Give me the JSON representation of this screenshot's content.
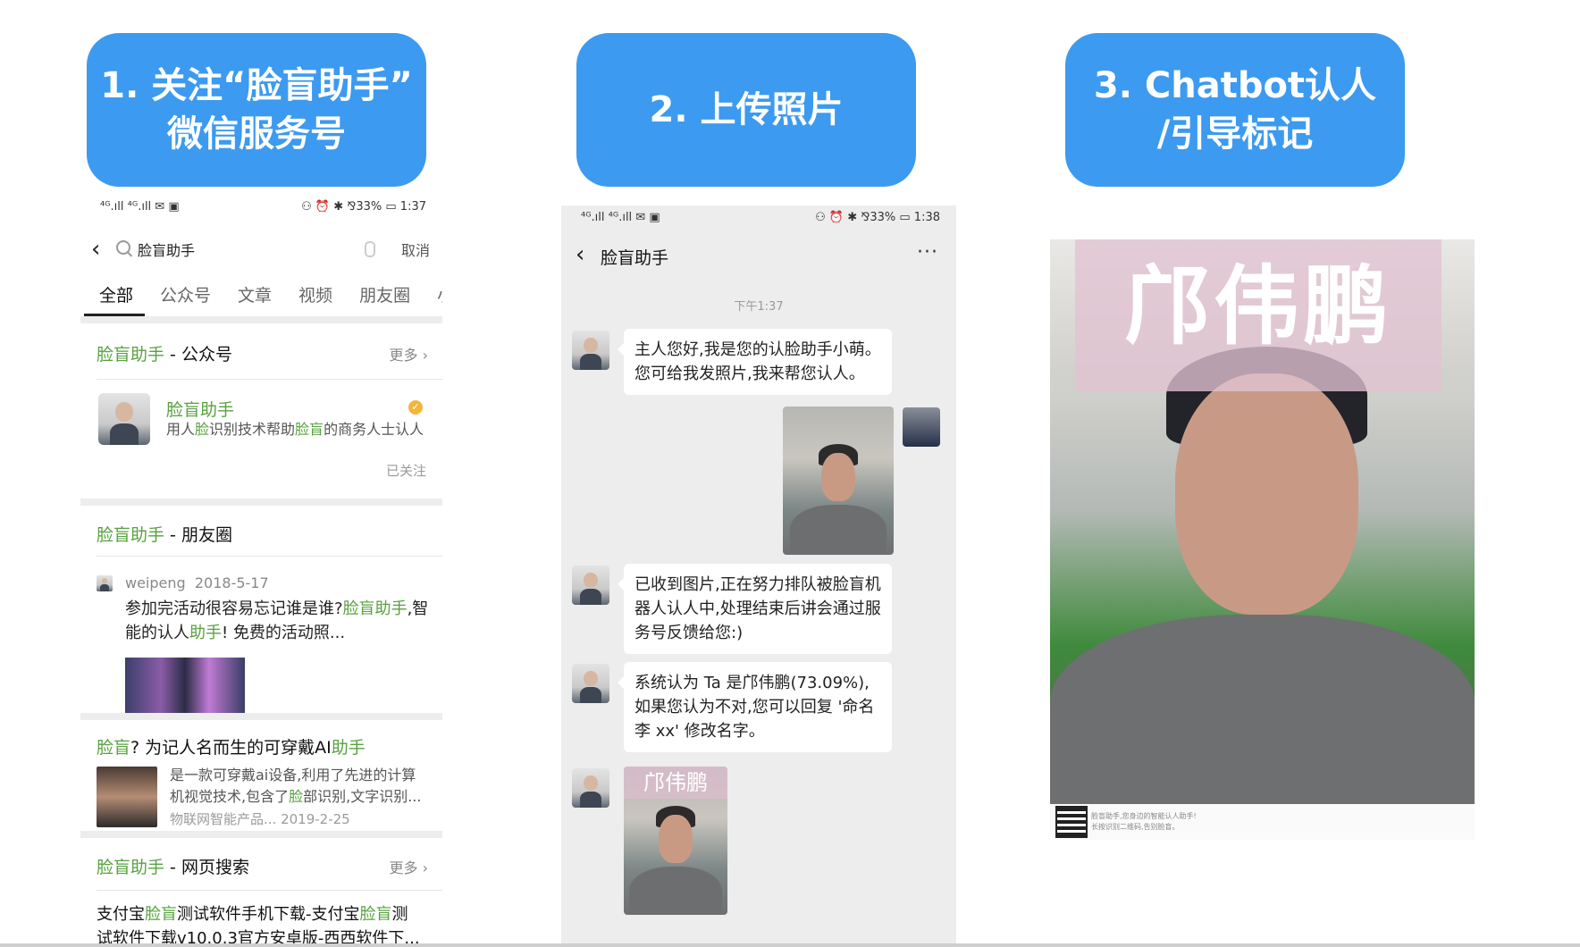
{
  "steps": [
    {
      "line1": "1. 关注“脸盲助手”",
      "line2": "微信服务号"
    },
    {
      "line1": "2. 上传照片",
      "line2": ""
    },
    {
      "line1": "3. Chatbot认人",
      "line2": "/引导标记"
    }
  ],
  "phone1": {
    "status_left": "⁴ᴳ.ıll ⁴ᴳ.ıll ✉ ▣",
    "status_right": "⚇ ⏰ ✱ ⅋33% ▭ 1:37",
    "search_query": "脸盲助手",
    "cancel": "取消",
    "tabs": [
      "全部",
      "公众号",
      "文章",
      "视频",
      "朋友圈",
      "小程"
    ],
    "official": {
      "title_hl": "脸盲助手",
      "title_rest": " - 公众号",
      "more": "更多",
      "account_name": "脸盲助手",
      "desc_parts": [
        "用人",
        "脸",
        "识别技术帮助",
        "脸盲",
        "的商务人士认人"
      ],
      "followed": "已关注"
    },
    "moments": {
      "title_hl": "脸盲助手",
      "title_rest": " - 朋友圈",
      "user": "weipeng",
      "date": "2018-5-17",
      "text_a": "参加完活动很容易忘记谁是谁?",
      "text_hl1": "脸盲助",
      "text_hl2": "手",
      "text_b": ",智能的认人",
      "text_hl3": "助手",
      "text_c": "! 免费的活动照..."
    },
    "article": {
      "title_hl1": "脸盲",
      "title_mid": "? 为记人名而生的可穿戴AI",
      "title_hl2": "助手",
      "desc_a": "是一款可穿戴ai设备,利用了先进的计算",
      "desc_b": "机视觉技术,包含了",
      "desc_hl": "脸",
      "desc_c": "部识别,文字识别...",
      "source": "物联网智能产品...",
      "date": "2019-2-25"
    },
    "web": {
      "title_hl": "脸盲助手",
      "title_rest": " - 网页搜索",
      "more": "更多",
      "line1_a": "支付宝",
      "line1_hl1": "脸盲",
      "line1_b": "测试软件手机下载-支付宝",
      "line1_hl2": "脸盲",
      "line1_c": "测",
      "line2": "试软件下载v10.0.3官方安卓版-西西软件下..."
    }
  },
  "phone2": {
    "status_left": "⁴ᴳ.ıll ⁴ᴳ.ıll ✉ ▣",
    "status_right": "⚇ ⏰ ✱ ⅋33% ▭ 1:38",
    "title": "脸盲助手",
    "menu": "···",
    "time": "下午1:37",
    "messages": [
      "主人您好,我是您的认脸助手小萌。您可给我发照片,我来帮您认人。",
      "已收到图片,正在努力排队被脸盲机器人认人中,处理结束后讲会通过服务号反馈给您:)",
      "系统认为 Ta 是邝伟鹏(73.09%),如果您认为不对,您可以回复 '命名 李 xx' 修改名字。"
    ],
    "result_name": "邝伟鹏"
  },
  "panel3": {
    "name": "邝伟鹏",
    "footer_line1": "脸盲助手,您身边的智能认人助手!",
    "footer_line2": "长按识别二维码,告别脸盲。"
  },
  "colors": {
    "banner": "#3c9af0",
    "highlight": "#57a23f",
    "chat_bg": "#ededed"
  }
}
